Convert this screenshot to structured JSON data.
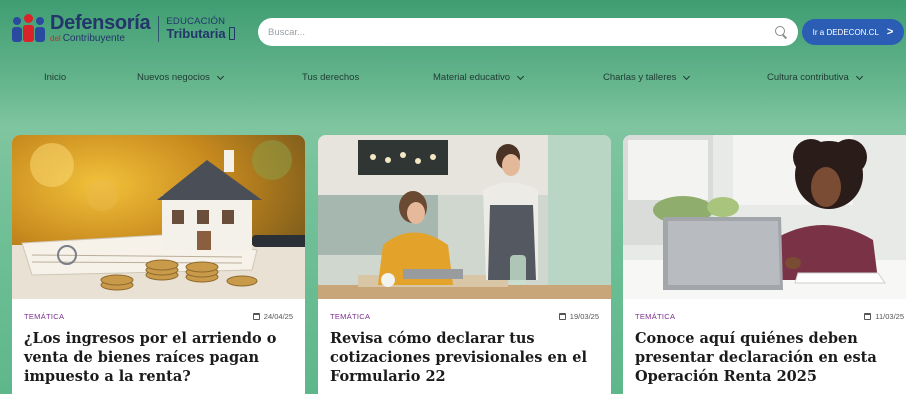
{
  "header": {
    "logo_title": "Defensoría",
    "logo_sub_prefix": "del",
    "logo_sub": "Contribuyente",
    "edu_top": "EDUCACIÓN",
    "edu_bottom": "Tributaria",
    "search_placeholder": "Buscar...",
    "dedecon_label": "Ir a DEDECON.CL",
    "dedecon_chevron": ">"
  },
  "nav": {
    "items": [
      {
        "label": "Inicio",
        "dropdown": false
      },
      {
        "label": "Nuevos negocios",
        "dropdown": true
      },
      {
        "label": "Tus derechos",
        "dropdown": false
      },
      {
        "label": "Material educativo",
        "dropdown": true
      },
      {
        "label": "Charlas y talleres",
        "dropdown": true
      },
      {
        "label": "Cultura contributiva",
        "dropdown": true
      }
    ]
  },
  "cards": [
    {
      "tag": "TEMÁTICA",
      "date": "24/04/25",
      "title": "¿Los ingresos por el arriendo o venta de bienes raíces pagan impuesto a la renta?",
      "image": "house-model-coins"
    },
    {
      "tag": "TEMÁTICA",
      "date": "19/03/25",
      "title": "Revisa cómo declarar tus cotizaciones previsionales en el Formulario 22",
      "image": "cafe-payment"
    },
    {
      "tag": "TEMÁTICA",
      "date": "11/03/25",
      "title": "Conoce aquí quiénes deben presentar declaración en esta Operación Renta 2025",
      "image": "woman-laptop"
    }
  ],
  "colors": {
    "brand_navy": "#23356b",
    "accent_red": "#d8232a",
    "button_blue": "#2a5db3",
    "hero_green": "#6fbf96",
    "tag_purple": "#7b2e8e"
  }
}
